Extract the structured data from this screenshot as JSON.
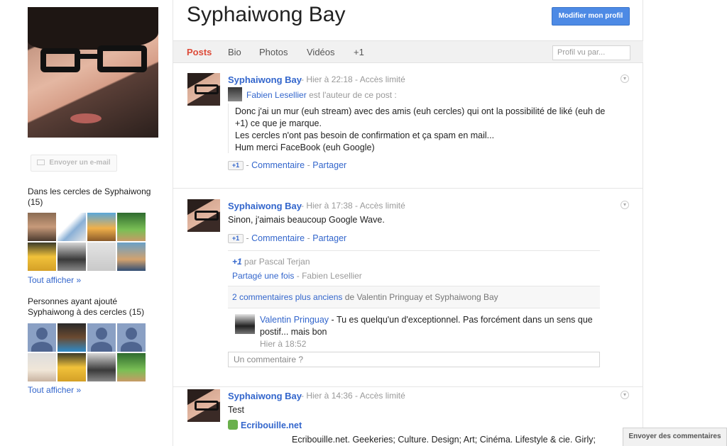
{
  "profile": {
    "name": "Syphaiwong Bay",
    "edit_button": "Modifier mon profil",
    "email_button": "Envoyer un e-mail"
  },
  "tabs": [
    "Posts",
    "Bio",
    "Photos",
    "Vidéos",
    "+1"
  ],
  "profile_search_placeholder": "Profil vu par...",
  "sidebar": {
    "in_circles_title": "Dans les cercles de Syphaiwong (15)",
    "show_all_1": "Tout afficher »",
    "added_title": "Personnes ayant ajouté Syphaiwong à des cercles (15)",
    "show_all_2": "Tout afficher »"
  },
  "posts": [
    {
      "author": "Syphaiwong Bay",
      "time": "Hier à 22:18",
      "access": "Accès limité",
      "reshare_author": "Fabien Lesellier",
      "reshare_suffix": "est l'auteur de ce post :",
      "lines": [
        "Donc j'ai un mur (euh stream) avec des amis (euh cercles) qui ont la possibilité de liké (euh de",
        "+1) ce que je marque.",
        "Les cercles n'ont pas besoin de confirmation et ça spam en mail...",
        "Hum merci FaceBook (euh Google)"
      ],
      "plus_label": "+1",
      "comment_label": "Commentaire",
      "share_label": "Partager"
    },
    {
      "author": "Syphaiwong Bay",
      "time": "Hier à 17:38",
      "access": "Accès limité",
      "text": "Sinon, j'aimais beaucoup Google Wave.",
      "plus_label": "+1",
      "comment_label": "Commentaire",
      "share_label": "Partager",
      "plus_by_label": "+1",
      "plus_by_text": "par Pascal Terjan",
      "shared_label": "Partagé une fois",
      "shared_by": "- Fabien Lesellier",
      "older_link": "2 commentaires plus anciens",
      "older_suffix": "de Valentin Pringuay et Syphaiwong Bay",
      "comment": {
        "author": "Valentin Pringuay",
        "text": "- Tu es quelqu'un d'exceptionnel. Pas forcément dans un sens que",
        "text2": "postif... mais bon",
        "time": "Hier à 18:52"
      },
      "comment_placeholder": "Un commentaire ?"
    },
    {
      "author": "Syphaiwong Bay",
      "time": "Hier à 14:36",
      "access": "Accès limité",
      "text": "Test",
      "link_title": "Ecribouille.net",
      "link_desc": "Ecribouille.net. Geekeries; Culture. Design; Art; Cinéma. Lifestyle & cie. Girly;"
    }
  ],
  "send_comments": "Envoyer des commentaires"
}
